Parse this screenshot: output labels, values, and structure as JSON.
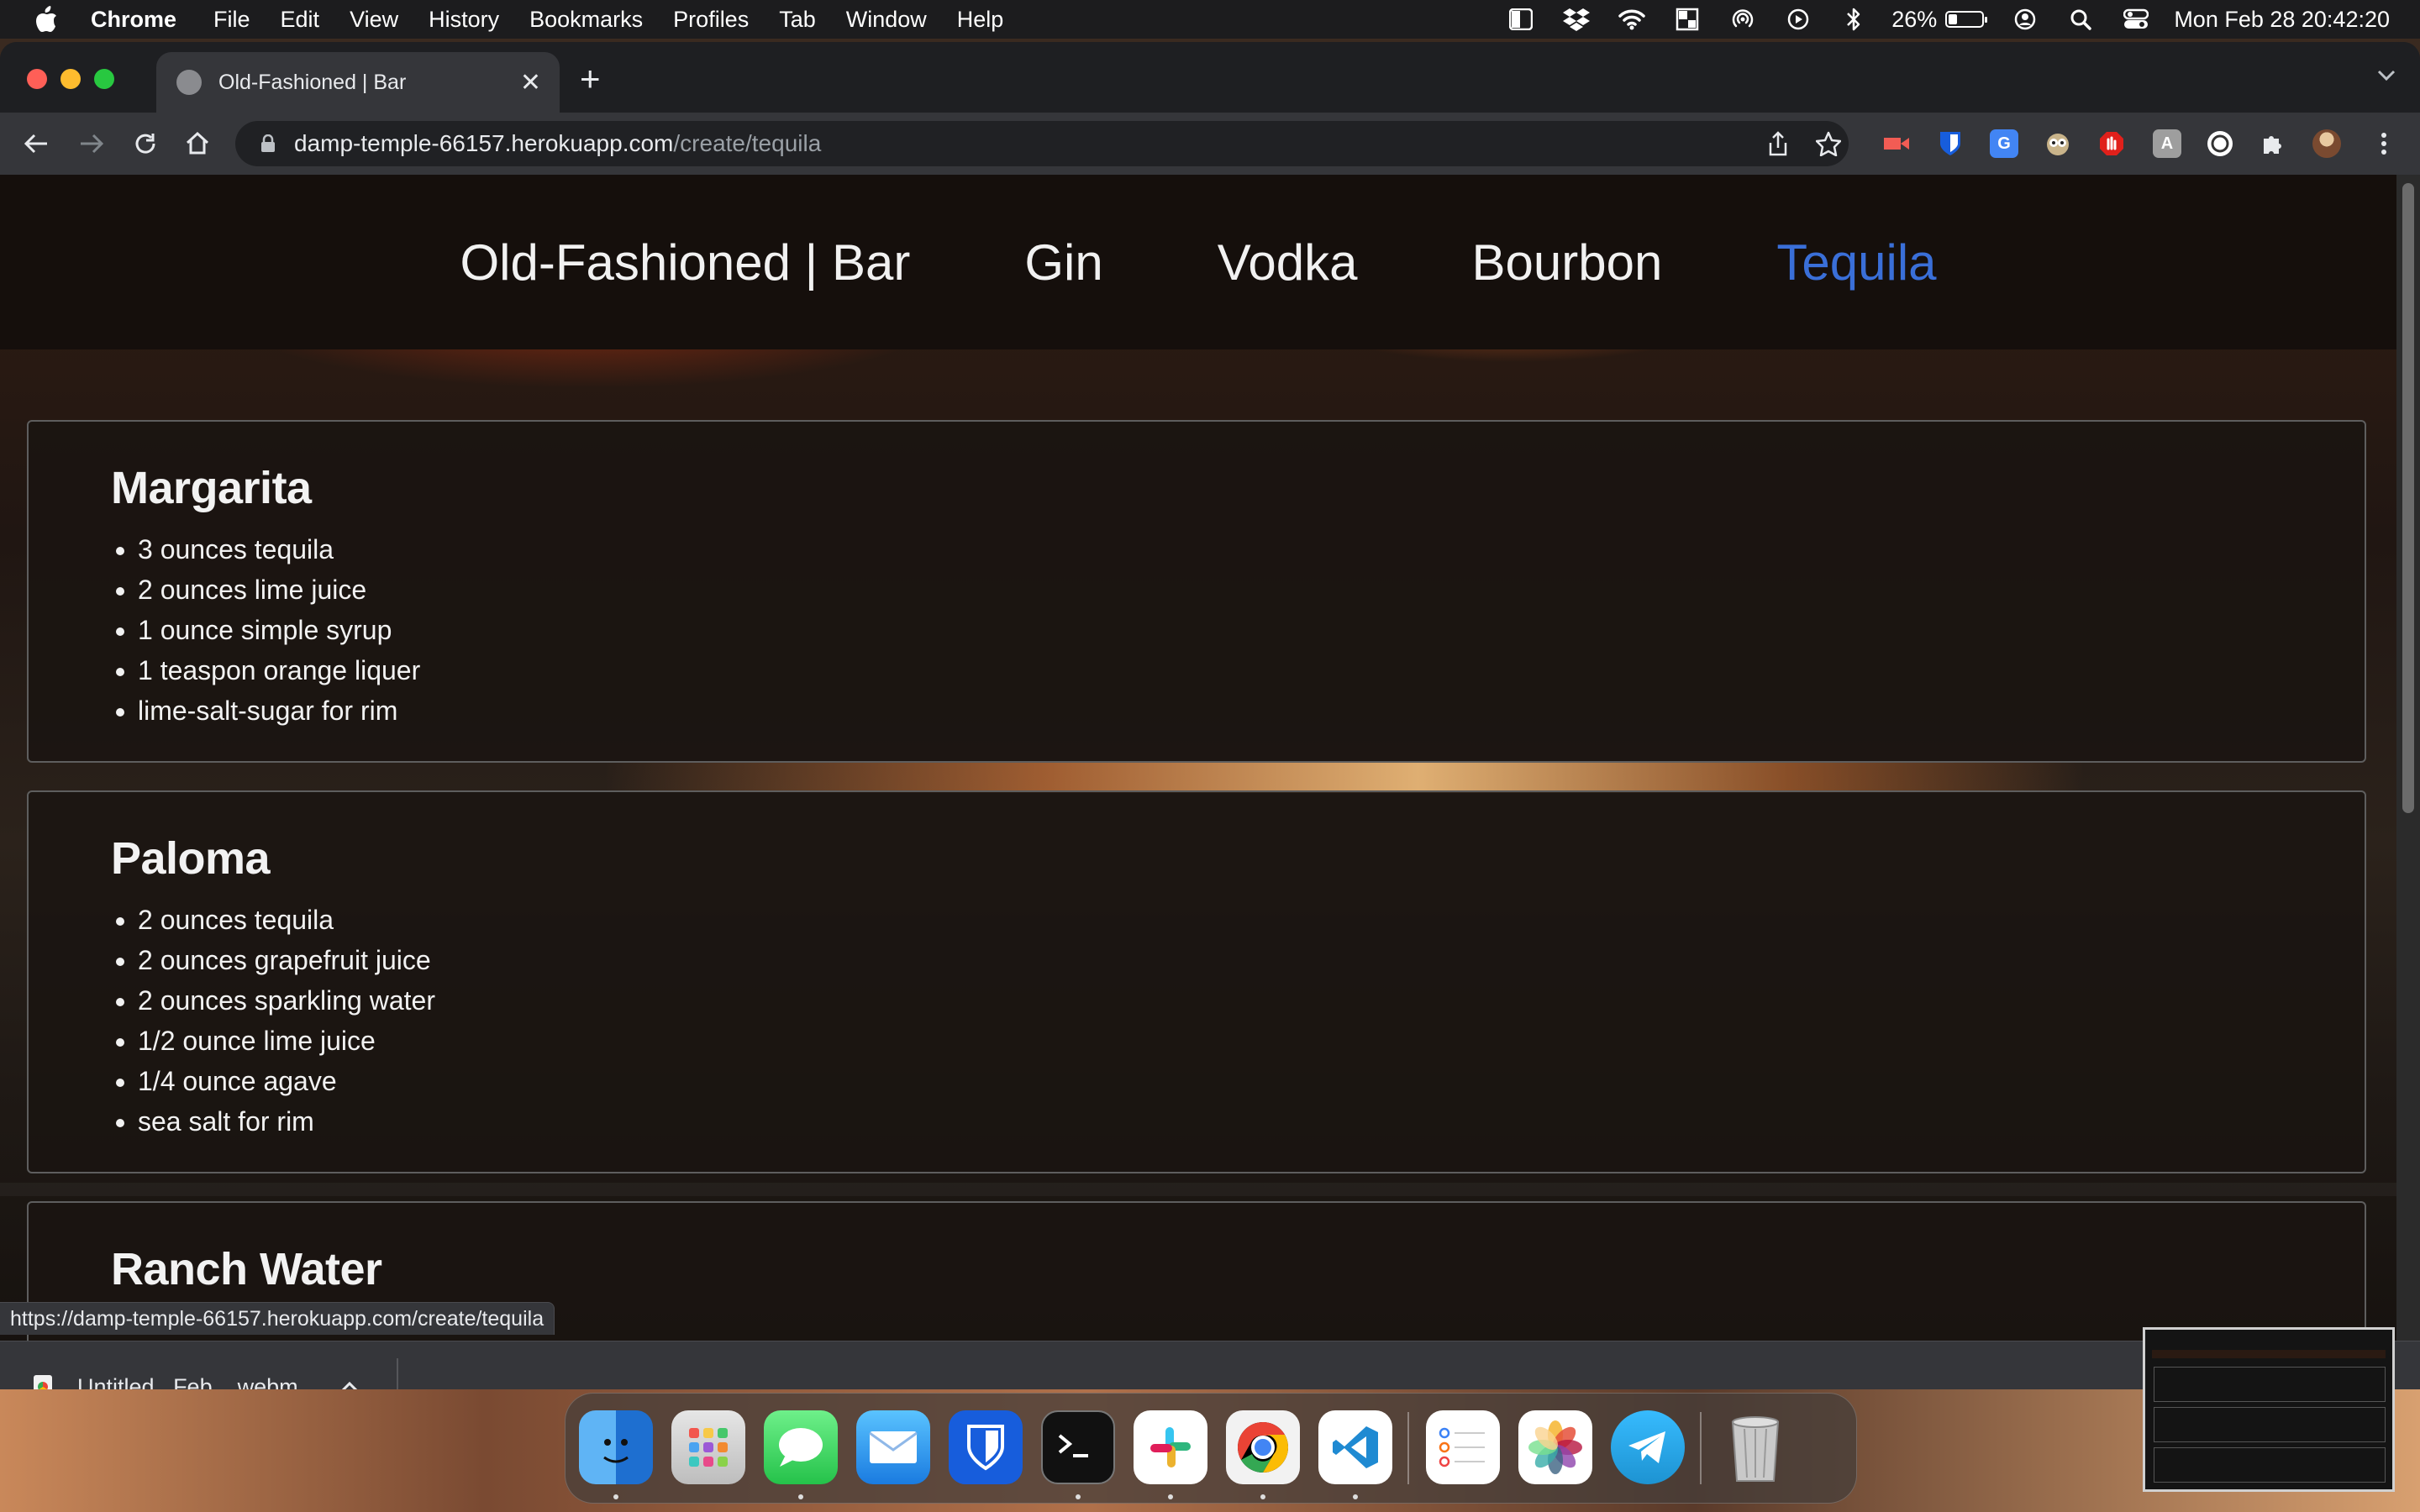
{
  "menubar": {
    "app_name": "Chrome",
    "items": [
      "File",
      "Edit",
      "View",
      "History",
      "Bookmarks",
      "Profiles",
      "Tab",
      "Window",
      "Help"
    ],
    "battery_percent": "26%",
    "battery_level": 0.26,
    "datetime": "Mon Feb 28  20:42:20"
  },
  "browser": {
    "tab_title": "Old-Fashioned | Bar",
    "url_host": "damp-temple-66157.herokuapp.com",
    "url_path": "/create/tequila",
    "status_url": "https://damp-temple-66157.herokuapp.com/create/tequila"
  },
  "site": {
    "brand": "Old-Fashioned | Bar",
    "nav": [
      "Gin",
      "Vodka",
      "Bourbon",
      "Tequila"
    ],
    "active_nav": "Tequila",
    "active_color": "#3a6fd8"
  },
  "recipes": [
    {
      "name": "Margarita",
      "ingredients": [
        "3 ounces tequila",
        "2 ounces lime juice",
        "1 ounce simple syrup",
        "1 teaspon orange liquer",
        "lime-salt-sugar for rim"
      ]
    },
    {
      "name": "Paloma",
      "ingredients": [
        "2 ounces tequila",
        "2 ounces grapefruit juice",
        "2 ounces sparkling water",
        "1/2 ounce lime juice",
        "1/4 ounce agave",
        "sea salt for rim"
      ]
    },
    {
      "name": "Ranch Water",
      "ingredients": []
    }
  ],
  "download": {
    "file_name": "Untitled_ Feb....webm"
  },
  "dock": {
    "apps": [
      "finder-icon",
      "launchpad-icon",
      "messages-icon",
      "mail-icon",
      "bitwarden-icon",
      "terminal-icon",
      "slack-icon",
      "chrome-icon",
      "vscode-icon",
      "reminders-icon",
      "photos-icon",
      "telegram-icon",
      "trash-icon"
    ]
  }
}
